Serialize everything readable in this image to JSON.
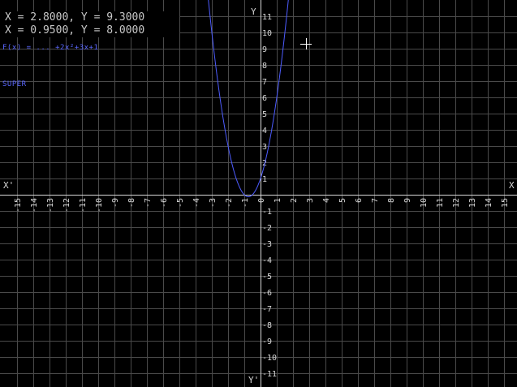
{
  "readouts": {
    "line1": "X = 2.8000, Y = 9.3000",
    "line2": "X = 0.9500, Y = 8.0000"
  },
  "formula": "F(x) = ... +2x²+3x+1",
  "mode": "SUPER",
  "axes": {
    "x_name": "X",
    "x_neg_name": "X'",
    "y_name": "Y",
    "y_neg_name": "Y'"
  },
  "colors": {
    "background": "#000000",
    "grid": "#4a4a4a",
    "axis": "#d8d8d8",
    "curve": "#4d5cff",
    "readout_text": "#c8c8c8"
  },
  "cursor": {
    "x": 2.8,
    "y": 9.3
  },
  "chart_data": {
    "type": "line",
    "function": "2x^2+3x+1",
    "series": [
      {
        "name": "F(x)",
        "coefficients": {
          "a": 2,
          "b": 3,
          "c": 1
        }
      }
    ],
    "xlim": [
      -15.5,
      15.5
    ],
    "ylim": [
      -11.5,
      11.5
    ],
    "x_ticks": [
      -15,
      -14,
      -13,
      -12,
      -11,
      -10,
      -9,
      -8,
      -7,
      -6,
      -5,
      -4,
      -3,
      -2,
      -1,
      0,
      1,
      2,
      3,
      4,
      5,
      6,
      7,
      8,
      9,
      10,
      11,
      12,
      13,
      14,
      15
    ],
    "y_ticks": [
      -11,
      -10,
      -9,
      -8,
      -7,
      -6,
      -5,
      -4,
      -3,
      -2,
      -1,
      1,
      2,
      3,
      4,
      5,
      6,
      7,
      8,
      9,
      10,
      11
    ],
    "grid": true
  }
}
